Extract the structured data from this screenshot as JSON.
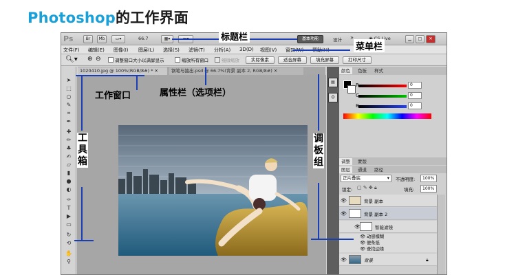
{
  "heading": {
    "latin": "Photoshop",
    "cn": "的工作界面"
  },
  "titlebar": {
    "logo": "Ps",
    "btn_br": "Br",
    "btn_mb": "Mb",
    "zoom": "66.7",
    "workspace_basic": "基本功能",
    "workspace_design": "设计",
    "more": "»",
    "cs_live": "CS Live",
    "min": "▁",
    "max": "□",
    "close": "✕"
  },
  "menubar": {
    "items": [
      "文件(F)",
      "编辑(E)",
      "图像(I)",
      "图层(L)",
      "选择(S)",
      "滤镜(T)",
      "分析(A)",
      "3D(D)",
      "视图(V)",
      "窗口(W)",
      "帮助(H)"
    ]
  },
  "optionsbar": {
    "resize_windows": "调整窗口大小以满屏显示",
    "zoom_all": "缩放所有窗口",
    "scrubby": "细微缩放",
    "actual_pixels": "实际像素",
    "fit_screen": "适合屏幕",
    "fill_screen": "填充屏幕",
    "print_size": "打印尺寸"
  },
  "tabs": [
    {
      "label": "1020410.jpg @ 100%(RGB/8#) *"
    },
    {
      "label": "钢笔与抽出.psd @ 66.7%(背景 副本 2, RGB/8#)"
    }
  ],
  "color_panel": {
    "tabs": [
      "颜色",
      "色板",
      "样式"
    ],
    "channels": [
      {
        "name": "R",
        "value": "0",
        "color": "#e02020"
      },
      {
        "name": "G",
        "value": "0",
        "color": "#20a020"
      },
      {
        "name": "B",
        "value": "0",
        "color": "#2040d0"
      }
    ]
  },
  "adjust_panel": {
    "tabs": [
      "调整",
      "蒙版"
    ]
  },
  "layers_panel": {
    "tabs": [
      "图层",
      "通道",
      "路径"
    ],
    "blend_mode": "正片叠底",
    "opacity_label": "不透明度:",
    "opacity": "100%",
    "lock_label": "锁定:",
    "fill_label": "填充:",
    "fill": "100%",
    "layers": [
      {
        "name": "背景 副本"
      },
      {
        "name": "背景 副本 2"
      },
      {
        "name": "智能滤镜"
      },
      {
        "name": "动感模糊"
      },
      {
        "name": "便条纸"
      },
      {
        "name": "查找边缘"
      },
      {
        "name": "背景"
      }
    ]
  },
  "annotations": {
    "title_bar": "标题栏",
    "menu_bar": "菜单栏",
    "work_window": "工作窗口",
    "options_bar": "属性栏（选项栏）",
    "toolbox": [
      "工",
      "具",
      "箱"
    ],
    "panels": [
      "调",
      "板",
      "组"
    ]
  }
}
